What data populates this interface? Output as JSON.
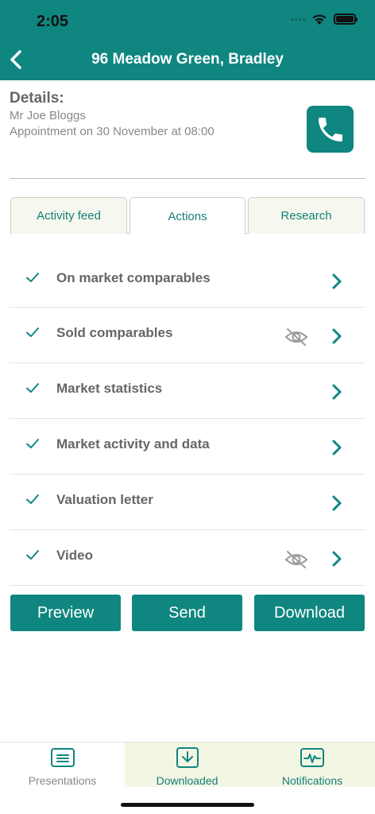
{
  "status": {
    "time": "2:05"
  },
  "header": {
    "title": "96 Meadow Green, Bradley"
  },
  "details": {
    "heading": "Details:",
    "name": "Mr Joe Bloggs",
    "appointment": "Appointment on 30 November at 08:00"
  },
  "tabs": [
    {
      "label": "Activity feed",
      "active": false
    },
    {
      "label": "Actions",
      "active": true
    },
    {
      "label": "Research",
      "active": false
    }
  ],
  "actions": [
    {
      "label": "On market comparables",
      "hidden": false
    },
    {
      "label": "Sold comparables",
      "hidden": true
    },
    {
      "label": "Market statistics",
      "hidden": false
    },
    {
      "label": "Market activity and data",
      "hidden": false
    },
    {
      "label": "Valuation letter",
      "hidden": false
    },
    {
      "label": "Video",
      "hidden": true
    }
  ],
  "buttons": {
    "preview": "Preview",
    "send": "Send",
    "download": "Download"
  },
  "nav": {
    "presentations": "Presentations",
    "downloaded": "Downloaded",
    "notifications": "Notifications"
  },
  "colors": {
    "accent": "#0f8680",
    "tab_bg": "#f6f7ee",
    "nav_highlight": "#f4f6e4"
  },
  "icons": {
    "back": "chevron-left-icon",
    "phone": "phone-icon",
    "check": "check-icon",
    "hidden": "eye-slash-icon",
    "chevron": "chevron-right-icon",
    "presentations": "presentation-icon",
    "downloaded": "download-icon",
    "notifications": "activity-icon"
  }
}
